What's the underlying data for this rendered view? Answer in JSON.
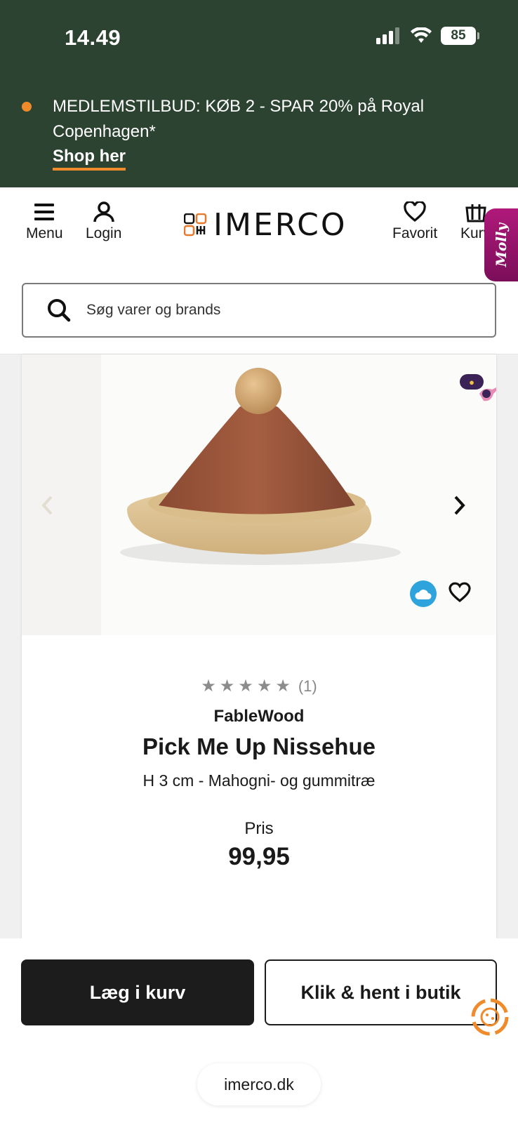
{
  "status_bar": {
    "time": "14.49",
    "battery": "85"
  },
  "promo": {
    "text": "MEDLEMSTILBUD: KØB 2 - SPAR 20% på Royal Copenhagen*",
    "link": "Shop her",
    "accent_color": "#f08b2b",
    "background_color": "#2c4331"
  },
  "header": {
    "menu_label": "Menu",
    "login_label": "Login",
    "logo_text": "IMERCO",
    "favorites_label": "Favorit",
    "cart_label": "Kurv",
    "molly_label": "Molly"
  },
  "search": {
    "placeholder": "Søg varer og brands"
  },
  "product": {
    "rating_count": "(1)",
    "rating_stars": 5,
    "brand": "FableWood",
    "title": "Pick Me Up Nissehue",
    "subtitle": "H 3 cm - Mahogni- og gummitræ",
    "price_label": "Pris",
    "price": "99,95"
  },
  "actions": {
    "add_to_cart": "Læg i kurv",
    "click_collect": "Klik & hent i butik"
  },
  "browser": {
    "url": "imerco.dk"
  }
}
